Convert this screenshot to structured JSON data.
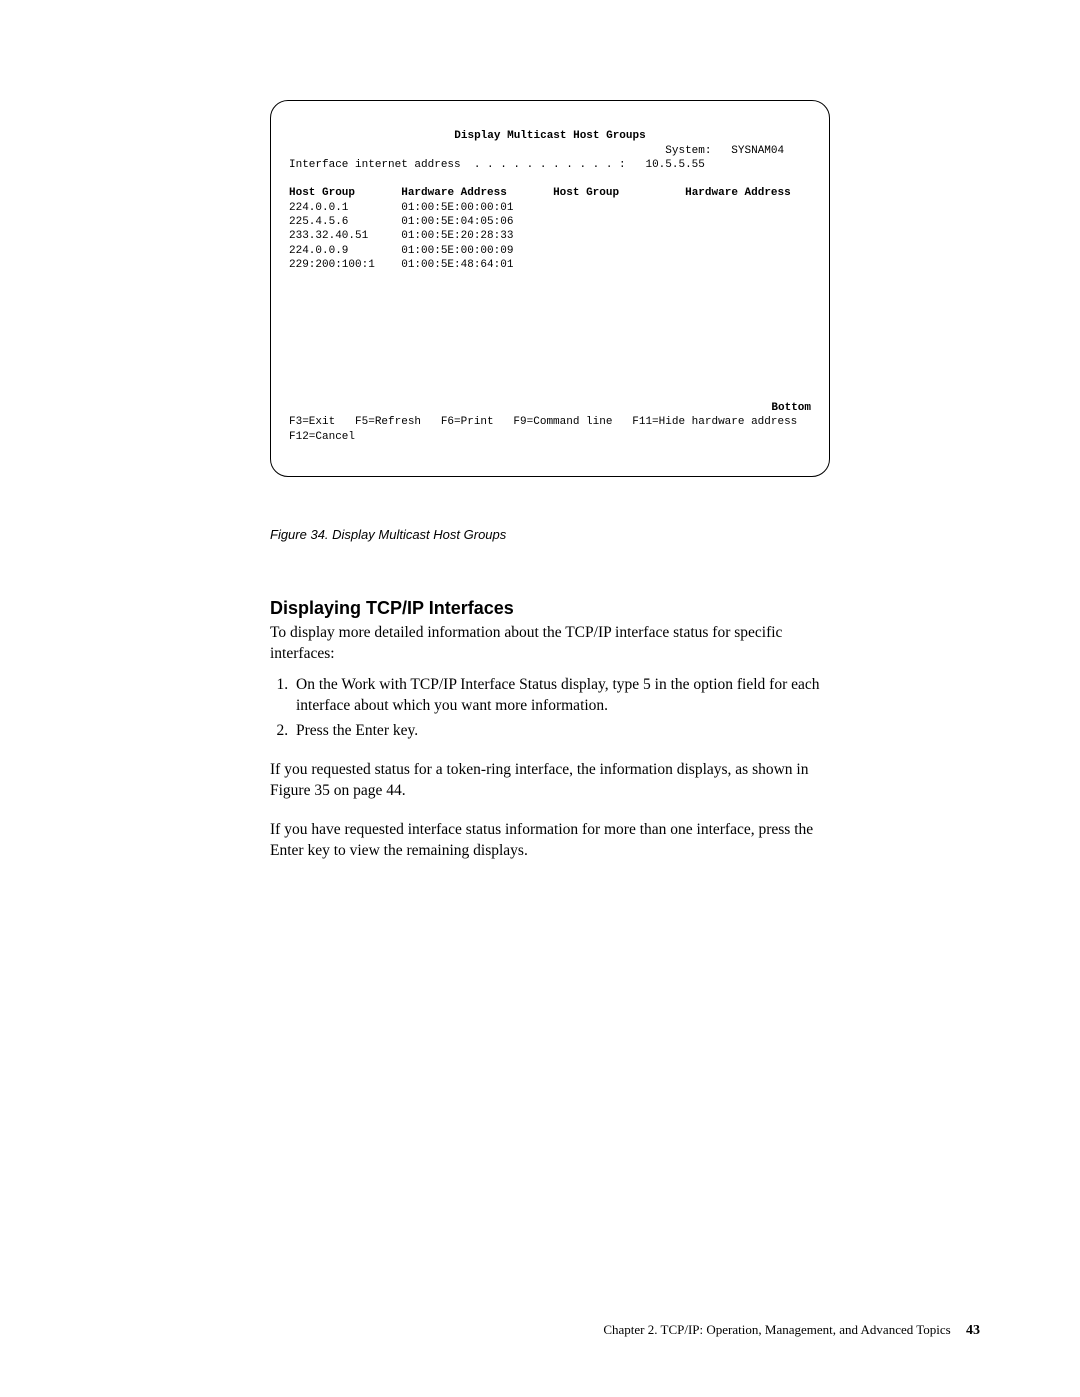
{
  "terminal": {
    "title": "Display Multicast Host Groups",
    "system_label": "System:",
    "system_value": "SYSNAM04",
    "iface_label": "Interface internet address  . . . . . . . . . . . :",
    "iface_value": "10.5.5.55",
    "col_hostgroup1": "Host Group",
    "col_hwaddr1": "Hardware Address",
    "col_hostgroup2": "Host Group",
    "col_hwaddr2": "Hardware Address",
    "rows": [
      {
        "hostgroup": "224.0.0.1",
        "hwaddr": "01:00:5E:00:00:01"
      },
      {
        "hostgroup": "225.4.5.6",
        "hwaddr": "01:00:5E:04:05:06"
      },
      {
        "hostgroup": "233.32.40.51",
        "hwaddr": "01:00:5E:20:28:33"
      },
      {
        "hostgroup": "224.0.0.9",
        "hwaddr": "01:00:5E:00:00:09"
      },
      {
        "hostgroup": "229:200:100:1",
        "hwaddr": "01:00:5E:48:64:01"
      }
    ],
    "bottom": "Bottom",
    "fkeys": "F3=Exit   F5=Refresh   F6=Print   F9=Command line   F11=Hide hardware address\nF12=Cancel"
  },
  "figure_caption": "Figure 34. Display Multicast Host Groups",
  "section_heading": "Displaying TCP/IP Interfaces",
  "intro_text": "To display more detailed information about the TCP/IP interface status for specific interfaces:",
  "steps": [
    "On the Work with TCP/IP Interface Status display, type 5 in the option field for each interface about which you want more information.",
    "Press the Enter key."
  ],
  "para1": "If you requested status for a token-ring interface, the information displays, as shown in Figure 35 on page 44.",
  "para2": "If you have requested interface status information for more than one interface, press the Enter key to view the remaining displays.",
  "footer_chapter": "Chapter 2. TCP/IP: Operation, Management, and Advanced Topics",
  "footer_page": "43"
}
